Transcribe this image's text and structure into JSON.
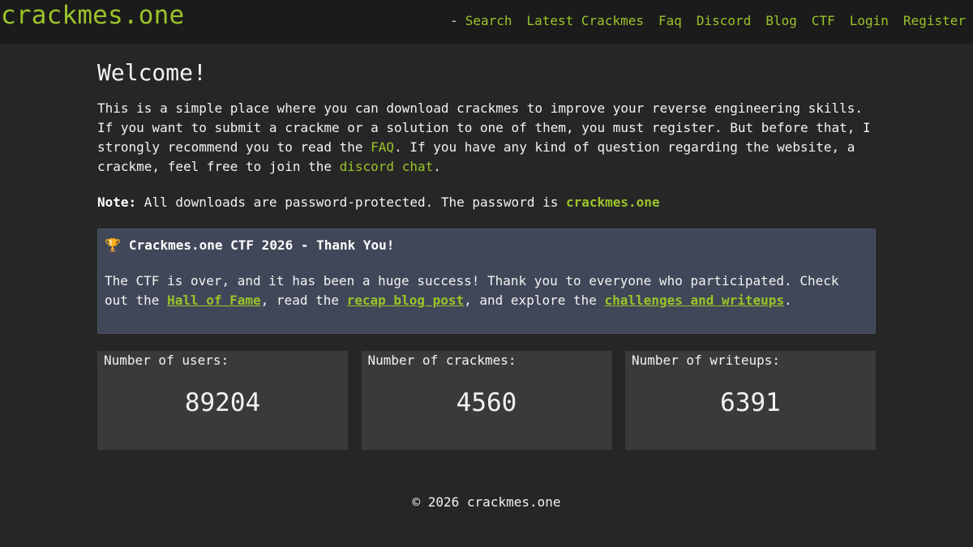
{
  "header": {
    "brand": "crackmes.one",
    "separator": "-",
    "nav": [
      "Search",
      "Latest Crackmes",
      "Faq",
      "Discord",
      "Blog",
      "CTF",
      "Login",
      "Register"
    ]
  },
  "main": {
    "title": "Welcome!",
    "intro": {
      "part1": "This is a simple place where you can download crackmes to improve your reverse engineering skills. If you want to submit a crackme or a solution to one of them, you must register. But before that, I strongly recommend you to read the ",
      "faq_link": "FAQ",
      "part2": ". If you have any kind of question regarding the website, a crackme, feel free to join the ",
      "discord_link": "discord chat",
      "part3": "."
    },
    "note": {
      "label": "Note:",
      "text": " All downloads are password-protected. The password is ",
      "password": "crackmes.one"
    },
    "announcement": {
      "icon": "trophy-icon",
      "title": "Crackmes.one CTF 2026 - Thank You!",
      "part1": "The CTF is over, and it has been a huge success! Thank you to everyone who participated. Check out the ",
      "hall_link": "Hall of Fame",
      "part2": ", read the ",
      "recap_link": "recap blog post",
      "part3": ", and explore the ",
      "challenges_link": "challenges and writeups",
      "part4": "."
    },
    "stats": [
      {
        "label": "Number of users:",
        "value": "89204"
      },
      {
        "label": "Number of crackmes:",
        "value": "4560"
      },
      {
        "label": "Number of writeups:",
        "value": "6391"
      }
    ]
  },
  "footer": {
    "text": "© 2026 crackmes.one"
  },
  "colors": {
    "accent": "#9ac42a",
    "background": "#262626",
    "header_bg": "#1b1b1b",
    "announcement_bg": "#404758",
    "stat_bg": "#3a3a3a"
  }
}
